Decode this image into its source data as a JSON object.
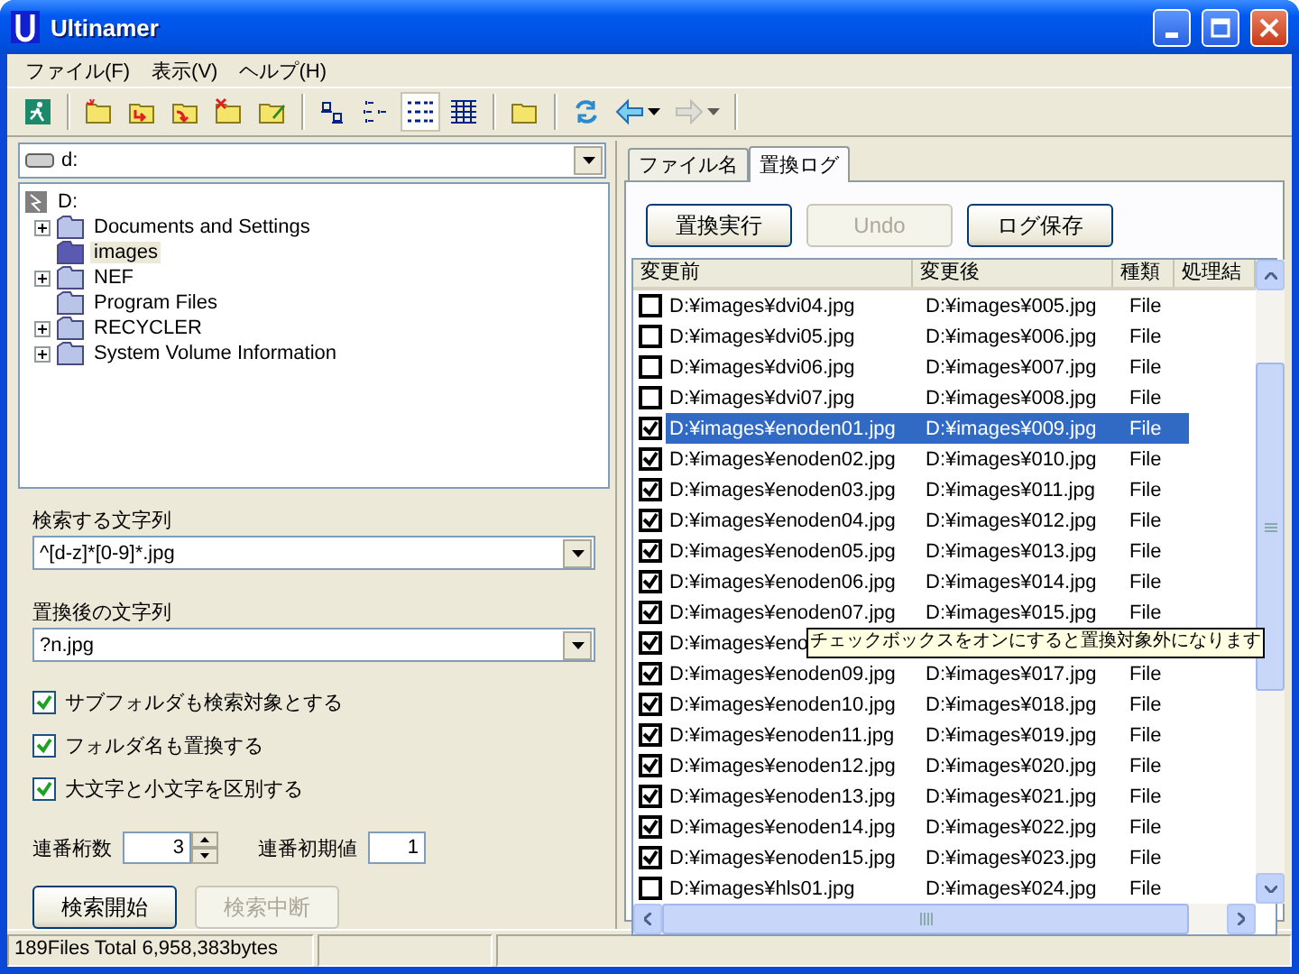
{
  "window": {
    "title": "Ultinamer"
  },
  "menu": [
    {
      "label": "ファイル(F)"
    },
    {
      "label": "表示(V)"
    },
    {
      "label": "ヘルプ(H)"
    }
  ],
  "toolbar": [
    {
      "selected": false,
      "disabled": false
    },
    {
      "selected": false,
      "disabled": false
    },
    {
      "selected": false,
      "disabled": false
    },
    {
      "selected": false,
      "disabled": false
    },
    {
      "selected": false,
      "disabled": false
    },
    {
      "selected": false,
      "disabled": false
    },
    {
      "selected": false,
      "disabled": false
    },
    {
      "selected": false,
      "disabled": false
    },
    {
      "selected": true,
      "disabled": false
    },
    {
      "selected": false,
      "disabled": false
    },
    {
      "selected": false,
      "disabled": false
    },
    {
      "selected": false,
      "disabled": false
    },
    {
      "selected": false,
      "disabled": false
    },
    {
      "selected": false,
      "disabled": true
    }
  ],
  "drive": {
    "value": "d:"
  },
  "tree": {
    "label": "D:",
    "children": [
      {
        "label": "Documents and Settings",
        "expandable": true,
        "selected": false
      },
      {
        "label": "images",
        "expandable": false,
        "selected": true
      },
      {
        "label": "NEF",
        "expandable": true,
        "selected": false
      },
      {
        "label": "Program Files",
        "expandable": false,
        "selected": false
      },
      {
        "label": "RECYCLER",
        "expandable": true,
        "selected": false
      },
      {
        "label": "System Volume Information",
        "expandable": true,
        "selected": false
      }
    ]
  },
  "search": {
    "label": "検索する文字列",
    "value": "^[d-z]*[0-9]*.jpg"
  },
  "replace": {
    "label": "置換後の文字列",
    "value": "?n.jpg"
  },
  "options": [
    {
      "label": "サブフォルダも検索対象とする",
      "checked": true
    },
    {
      "label": "フォルダ名も置換する",
      "checked": true
    },
    {
      "label": "大文字と小文字を区別する",
      "checked": true
    }
  ],
  "digits": {
    "label": "連番桁数",
    "value": "3"
  },
  "start": {
    "label": "連番初期値",
    "value": "1"
  },
  "left_buttons": [
    {
      "label": "検索開始",
      "disabled": false
    },
    {
      "label": "検索中断",
      "disabled": true
    }
  ],
  "status_bar": {
    "text": "189Files  Total 6,958,383bytes"
  },
  "tabs": [
    {
      "label": "ファイル名",
      "selected": false
    },
    {
      "label": "置換ログ",
      "selected": true
    }
  ],
  "log_buttons": [
    {
      "label": "置換実行",
      "disabled": false
    },
    {
      "label": "Undo",
      "disabled": true
    },
    {
      "label": "ログ保存",
      "disabled": false
    }
  ],
  "table": {
    "columns": [
      "変更前",
      "変更後",
      "種類",
      "処理結"
    ],
    "rows": [
      {
        "before": "D:¥images¥dvi04.jpg",
        "after": "D:¥images¥005.jpg",
        "type": "File",
        "checked": false,
        "selected": false
      },
      {
        "before": "D:¥images¥dvi05.jpg",
        "after": "D:¥images¥006.jpg",
        "type": "File",
        "checked": false,
        "selected": false
      },
      {
        "before": "D:¥images¥dvi06.jpg",
        "after": "D:¥images¥007.jpg",
        "type": "File",
        "checked": false,
        "selected": false
      },
      {
        "before": "D:¥images¥dvi07.jpg",
        "after": "D:¥images¥008.jpg",
        "type": "File",
        "checked": false,
        "selected": false
      },
      {
        "before": "D:¥images¥enoden01.jpg",
        "after": "D:¥images¥009.jpg",
        "type": "File",
        "checked": true,
        "selected": true
      },
      {
        "before": "D:¥images¥enoden02.jpg",
        "after": "D:¥images¥010.jpg",
        "type": "File",
        "checked": true,
        "selected": false
      },
      {
        "before": "D:¥images¥enoden03.jpg",
        "after": "D:¥images¥011.jpg",
        "type": "File",
        "checked": true,
        "selected": false
      },
      {
        "before": "D:¥images¥enoden04.jpg",
        "after": "D:¥images¥012.jpg",
        "type": "File",
        "checked": true,
        "selected": false
      },
      {
        "before": "D:¥images¥enoden05.jpg",
        "after": "D:¥images¥013.jpg",
        "type": "File",
        "checked": true,
        "selected": false
      },
      {
        "before": "D:¥images¥enoden06.jpg",
        "after": "D:¥images¥014.jpg",
        "type": "File",
        "checked": true,
        "selected": false
      },
      {
        "before": "D:¥images¥enoden07.jpg",
        "after": "D:¥images¥015.jpg",
        "type": "File",
        "checked": true,
        "selected": false
      },
      {
        "before": "D:¥images¥eno",
        "checked": true,
        "selected": false
      },
      {
        "before": "D:¥images¥enoden09.jpg",
        "after": "D:¥images¥017.jpg",
        "type": "File",
        "checked": true,
        "selected": false
      },
      {
        "before": "D:¥images¥enoden10.jpg",
        "after": "D:¥images¥018.jpg",
        "type": "File",
        "checked": true,
        "selected": false
      },
      {
        "before": "D:¥images¥enoden11.jpg",
        "after": "D:¥images¥019.jpg",
        "type": "File",
        "checked": true,
        "selected": false
      },
      {
        "before": "D:¥images¥enoden12.jpg",
        "after": "D:¥images¥020.jpg",
        "type": "File",
        "checked": true,
        "selected": false
      },
      {
        "before": "D:¥images¥enoden13.jpg",
        "after": "D:¥images¥021.jpg",
        "type": "File",
        "checked": true,
        "selected": false
      },
      {
        "before": "D:¥images¥enoden14.jpg",
        "after": "D:¥images¥022.jpg",
        "type": "File",
        "checked": true,
        "selected": false
      },
      {
        "before": "D:¥images¥enoden15.jpg",
        "after": "D:¥images¥023.jpg",
        "type": "File",
        "checked": true,
        "selected": false
      },
      {
        "before": "D:¥images¥hls01.jpg",
        "after": "D:¥images¥024.jpg",
        "type": "File",
        "checked": false,
        "selected": false
      }
    ]
  },
  "tooltip": {
    "text": "チェックボックスをオンにすると置換対象外になります"
  }
}
